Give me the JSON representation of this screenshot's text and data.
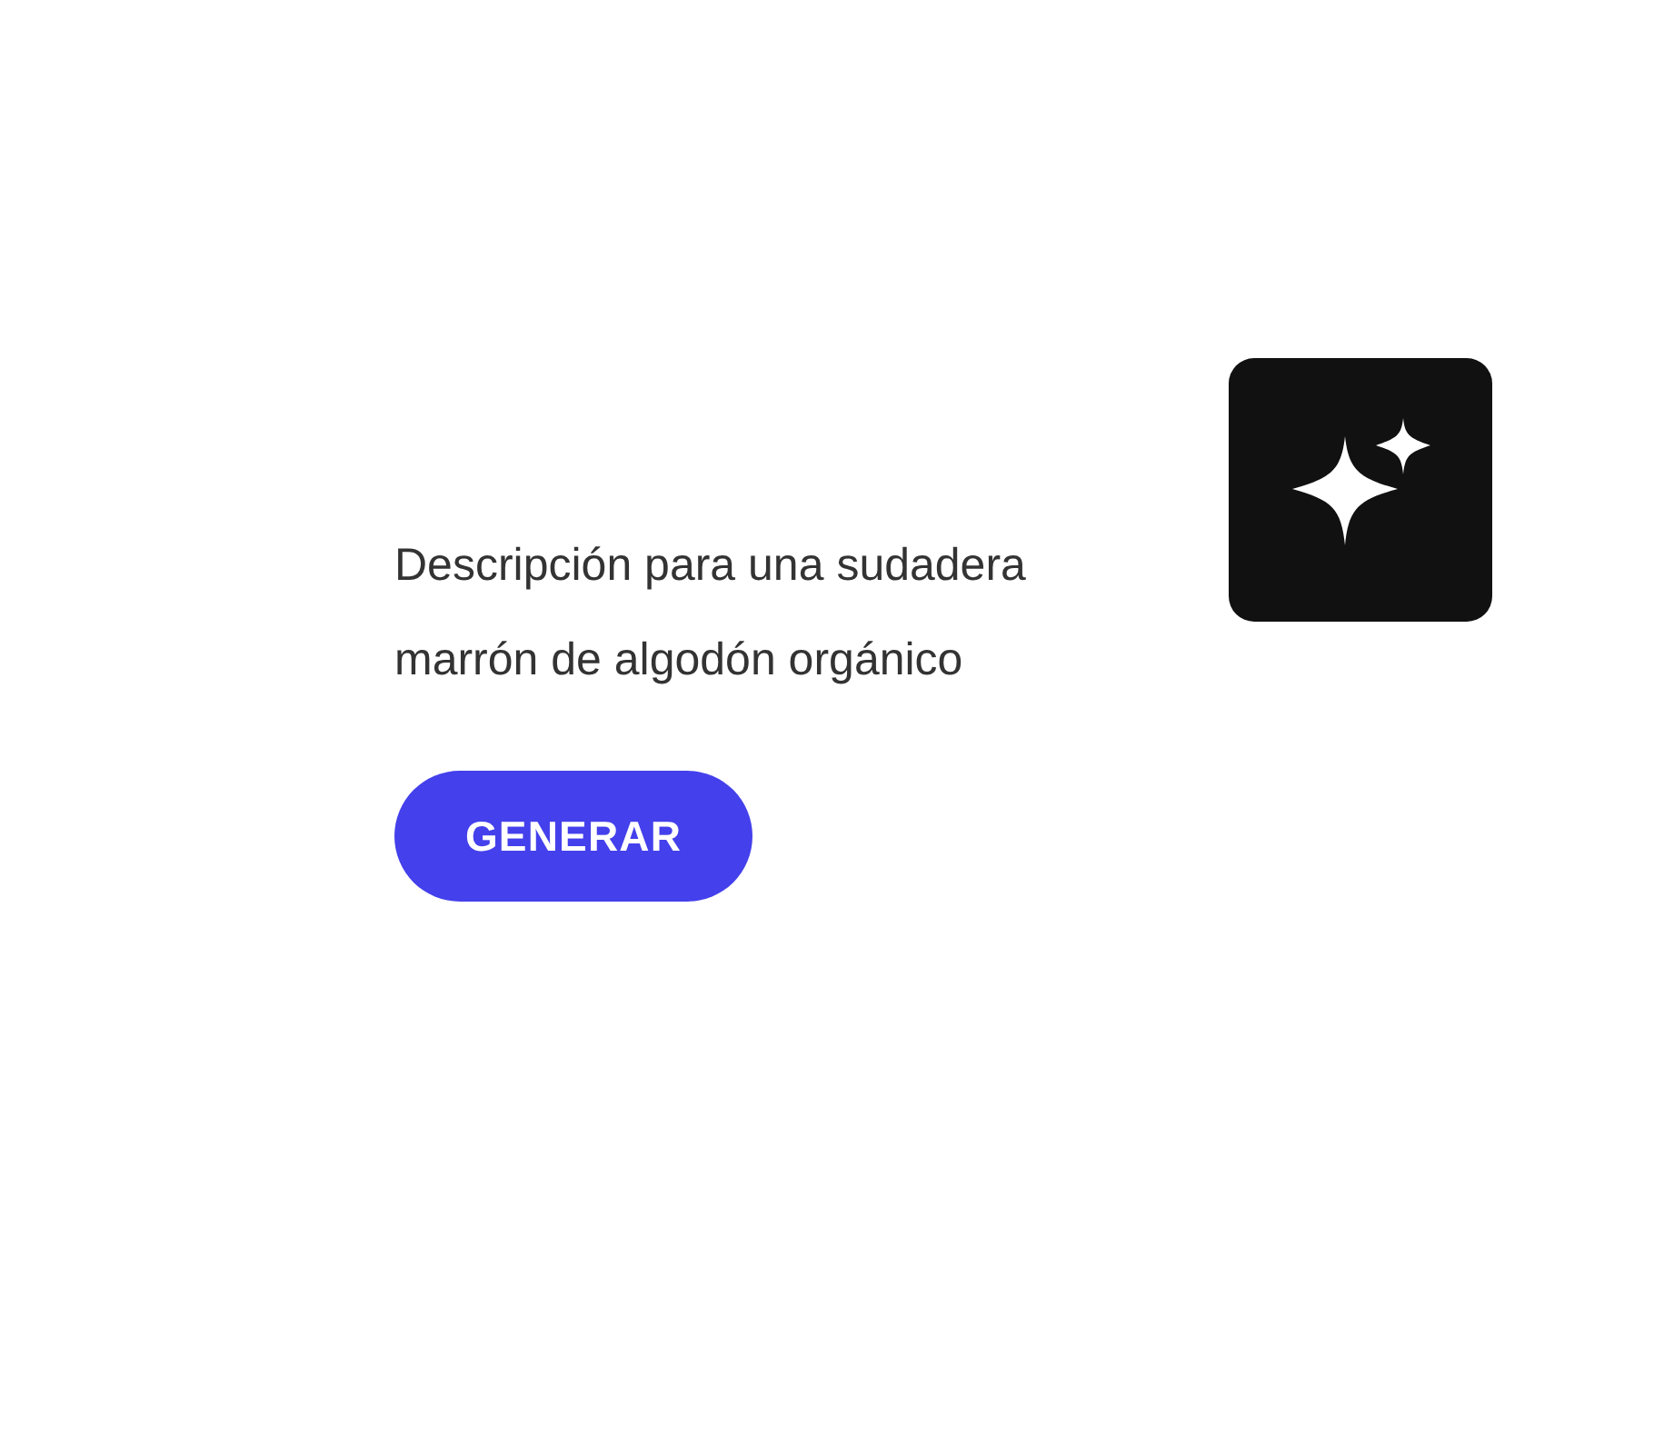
{
  "description": "Descripción para una sudadera marrón de algodón orgánico",
  "button": {
    "label": "GENERAR"
  }
}
